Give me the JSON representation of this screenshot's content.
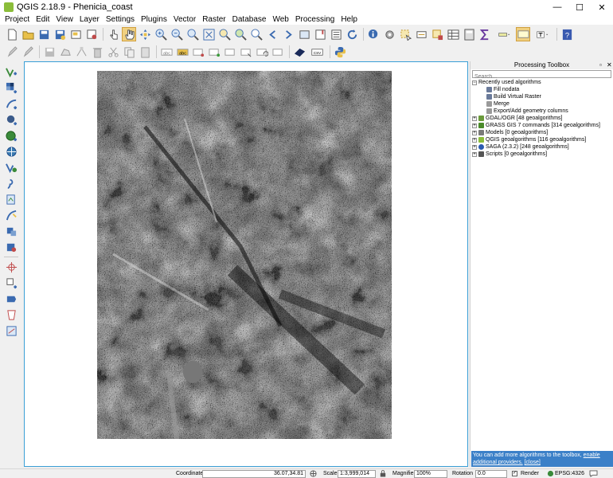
{
  "window": {
    "title": "QGIS 2.18.9 - Phenicia_coast",
    "controls": {
      "minimize": "—",
      "maximize": "☐",
      "close": "✕"
    }
  },
  "menubar": {
    "items": [
      "Project",
      "Edit",
      "View",
      "Layer",
      "Settings",
      "Plugins",
      "Vector",
      "Raster",
      "Database",
      "Web",
      "Processing",
      "Help"
    ]
  },
  "map_canvas": {
    "raster_layer": "Phenicia_coast",
    "border_color": "#3a9fd6"
  },
  "processing_toolbox": {
    "title": "Processing Toolbox",
    "float_glyph": "▫",
    "close_glyph": "✕",
    "search_placeholder": "Search...",
    "recent": {
      "label": "Recently used algorithms",
      "items": [
        "Fill nodata",
        "Build Virtual Raster",
        "Merge",
        "Export/Add geometry columns"
      ]
    },
    "providers": [
      {
        "label": "GDAL/OGR [48 geoalgorithms]",
        "icon": "gdal-icon",
        "color": "#6a9a3a"
      },
      {
        "label": "GRASS GIS 7 commands [314 geoalgorithms]",
        "icon": "grass-icon",
        "color": "#4a8a2a"
      },
      {
        "label": "Models [0 geoalgorithms]",
        "icon": "models-icon",
        "color": "#7a7a7a"
      },
      {
        "label": "QGIS geoalgorithms [116 geoalgorithms]",
        "icon": "qgis-icon",
        "color": "#8bbd3a"
      },
      {
        "label": "SAGA (2.3.2) [248 geoalgorithms]",
        "icon": "saga-icon",
        "color": "#2a5ab0"
      },
      {
        "label": "Scripts [0 geoalgorithms]",
        "icon": "scripts-icon",
        "color": "#555555"
      }
    ],
    "note": {
      "text": "You can add more algorithms to the toolbox, ",
      "link": "enable additional providers.",
      "close": "[close]"
    }
  },
  "statusbar": {
    "coordinate_label": "Coordinate",
    "coordinate_value": "36.07,34.81",
    "scale_label": "Scale",
    "scale_value": "1:3,999,014",
    "magnifier_label": "Magnifier",
    "magnifier_value": "100%",
    "rotation_label": "Rotation",
    "rotation_value": "0.0",
    "render_label": "Render",
    "render_checked": true,
    "crs_label": "EPSG:4326"
  },
  "colors": {
    "accent": "#3a9fd6",
    "note_bg": "#3b80c8",
    "qgis_green": "#8bbd3a"
  }
}
